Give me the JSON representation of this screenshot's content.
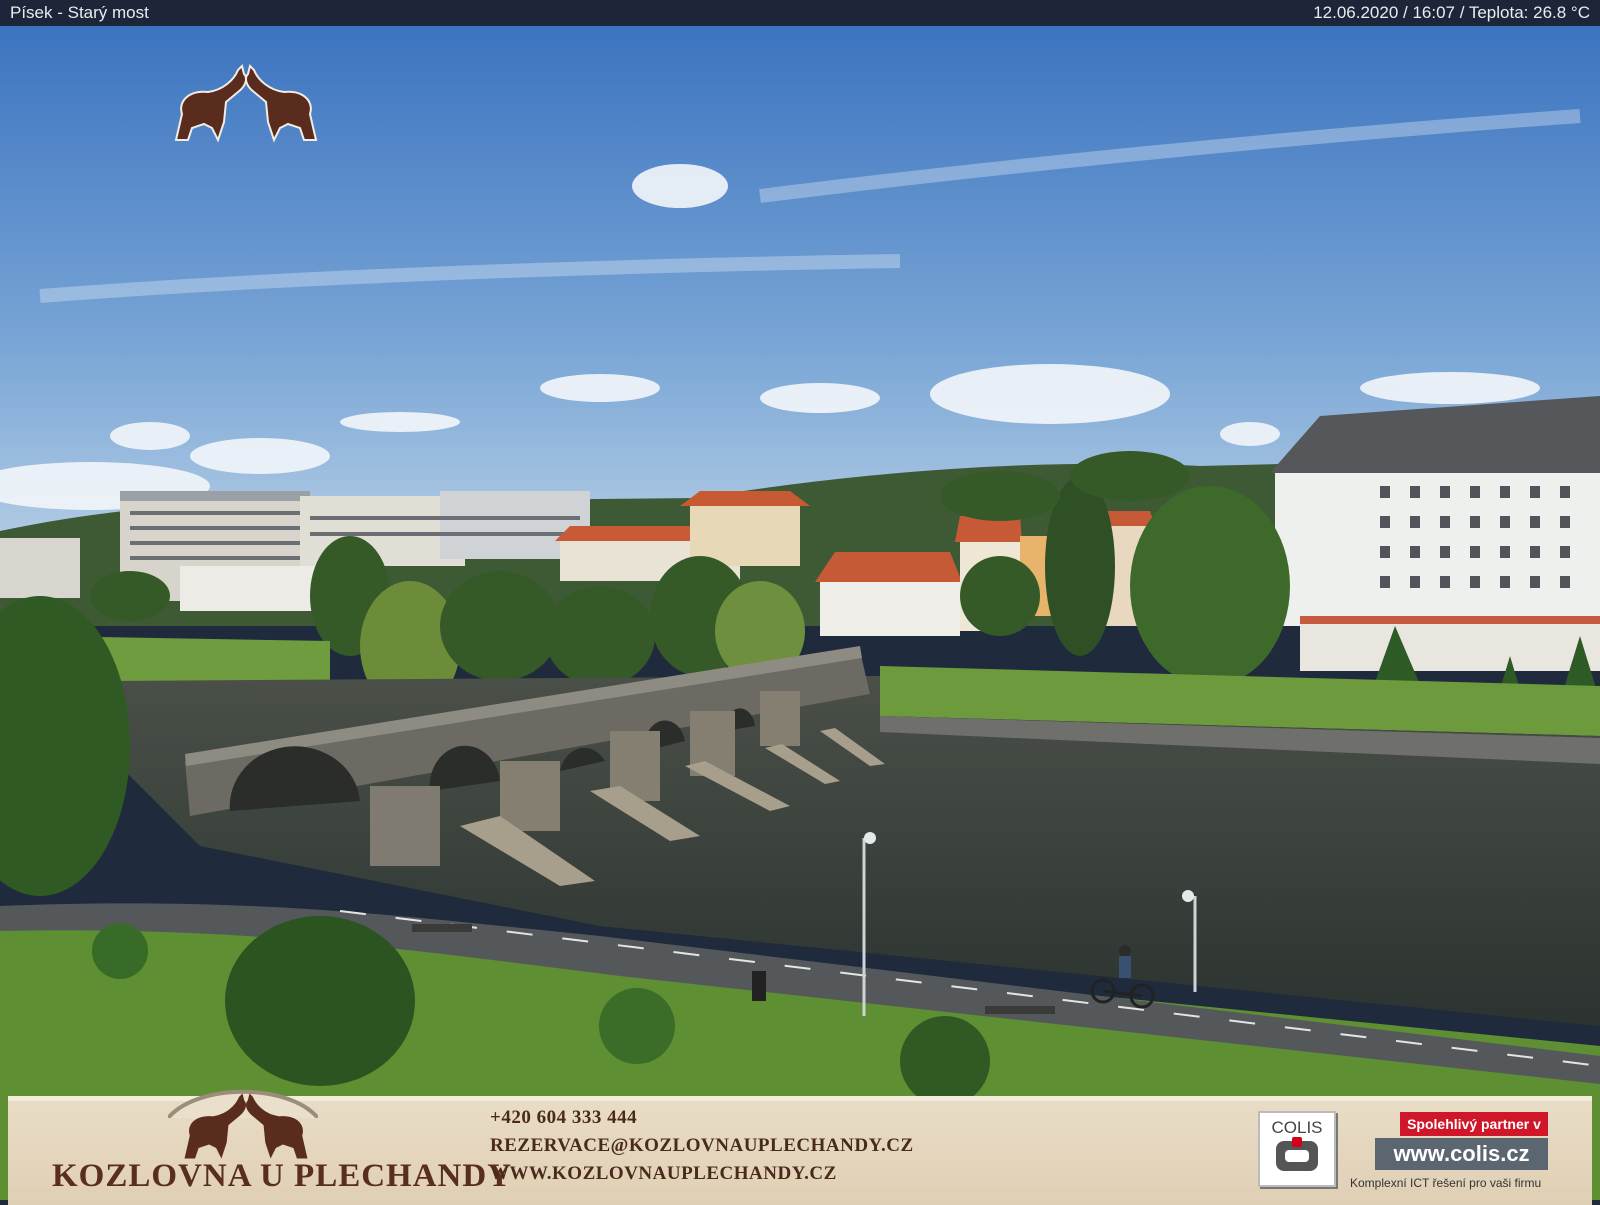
{
  "header": {
    "location": "Písek - Starý most",
    "status": "12.06.2020 / 16:07 / Teplota: 26.8 °C"
  },
  "footer": {
    "brand": "KOZLOVNA U PLECHANDY",
    "phone": "+420 604 333 444",
    "email": "REZERVACE@KOZLOVNAUPLECHANDY.CZ",
    "web": "WWW.KOZLOVNAUPLECHANDY.CZ",
    "sponsor": {
      "logo_word": "COLIS",
      "partner_badge": "Spolehlivý partner v IT",
      "url": "www.colis.cz",
      "tagline": "Komplexní ICT řešení pro vaši firmu"
    }
  },
  "colors": {
    "sky_top": "#3f78c3",
    "sky_bottom": "#a9c7e4",
    "river": "#39403a",
    "grass": "#6a9a3a",
    "accent_red": "#d0172a",
    "brand_brown": "#5a2e1f"
  }
}
